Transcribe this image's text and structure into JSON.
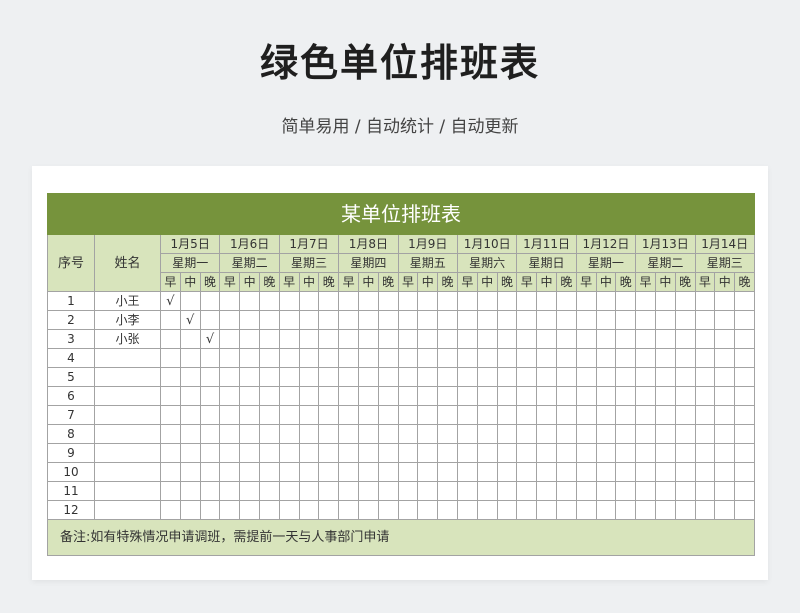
{
  "header": {
    "title": "绿色单位排班表",
    "subtitle": "简单易用 / 自动统计 / 自动更新"
  },
  "sheet": {
    "title": "某单位排班表",
    "col_seq": "序号",
    "col_name": "姓名",
    "days": [
      {
        "date": "1月5日",
        "weekday": "星期一"
      },
      {
        "date": "1月6日",
        "weekday": "星期二"
      },
      {
        "date": "1月7日",
        "weekday": "星期三"
      },
      {
        "date": "1月8日",
        "weekday": "星期四"
      },
      {
        "date": "1月9日",
        "weekday": "星期五"
      },
      {
        "date": "1月10日",
        "weekday": "星期六"
      },
      {
        "date": "1月11日",
        "weekday": "星期日"
      },
      {
        "date": "1月12日",
        "weekday": "星期一"
      },
      {
        "date": "1月13日",
        "weekday": "星期二"
      },
      {
        "date": "1月14日",
        "weekday": "星期三"
      }
    ],
    "shifts": [
      "早",
      "中",
      "晚"
    ],
    "check_mark": "√",
    "rows": [
      {
        "seq": "1",
        "name": "小王",
        "checks": [
          0
        ]
      },
      {
        "seq": "2",
        "name": "小李",
        "checks": [
          1
        ]
      },
      {
        "seq": "3",
        "name": "小张",
        "checks": [
          2
        ]
      },
      {
        "seq": "4",
        "name": "",
        "checks": []
      },
      {
        "seq": "5",
        "name": "",
        "checks": []
      },
      {
        "seq": "6",
        "name": "",
        "checks": []
      },
      {
        "seq": "7",
        "name": "",
        "checks": []
      },
      {
        "seq": "8",
        "name": "",
        "checks": []
      },
      {
        "seq": "9",
        "name": "",
        "checks": []
      },
      {
        "seq": "10",
        "name": "",
        "checks": []
      },
      {
        "seq": "11",
        "name": "",
        "checks": []
      },
      {
        "seq": "12",
        "name": "",
        "checks": []
      }
    ],
    "note": "备注:如有特殊情况申请调班，需提前一天与人事部门申请"
  },
  "colors": {
    "title_bar": "#76933c",
    "header_fill": "#d8e4bc",
    "grid_line": "#a3a3a3"
  }
}
